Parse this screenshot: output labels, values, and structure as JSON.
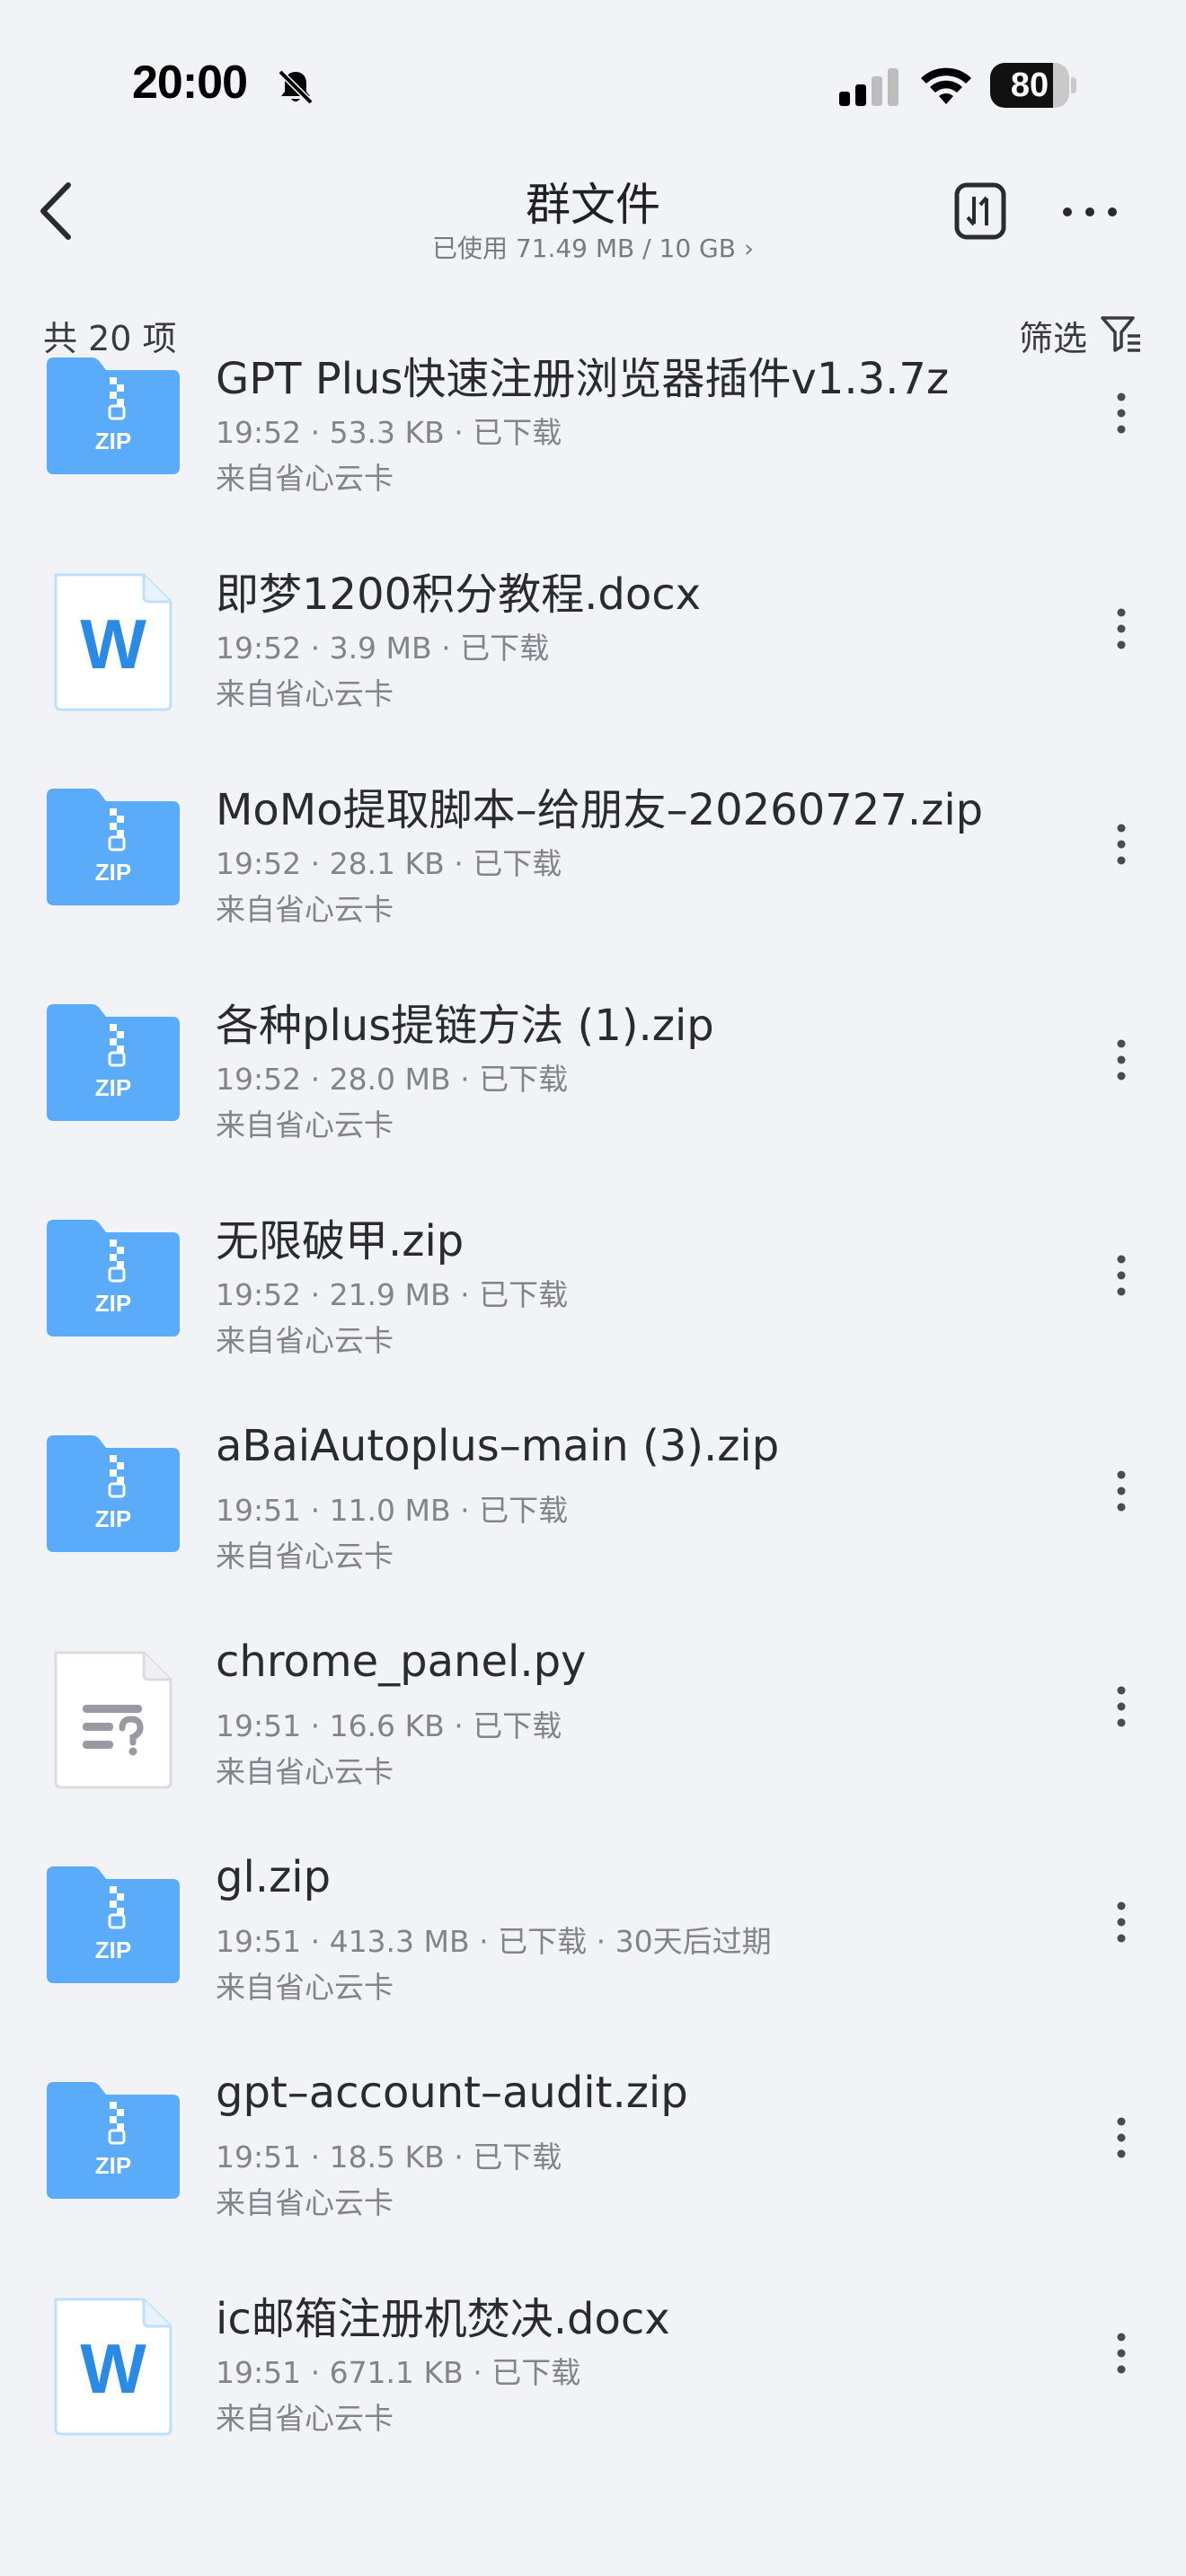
{
  "status": {
    "time": "20:00",
    "battery": "80",
    "battery_level": 0.8
  },
  "header": {
    "title": "群文件",
    "usage": "已使用 71.49 MB / 10 GB ›"
  },
  "toolbar": {
    "count": "共 20 项",
    "filter": "筛选"
  },
  "files": [
    {
      "icon": "zip",
      "name": "GPT Plus快速注册浏览器插件v1.3.7z",
      "meta": "19:52 · 53.3 KB · 已下载",
      "source": "来自省心云卡"
    },
    {
      "icon": "word",
      "name": "即梦1200积分教程.docx",
      "meta": "19:52 · 3.9 MB · 已下载",
      "source": "来自省心云卡"
    },
    {
      "icon": "zip",
      "name": "MoMo提取脚本–给朋友–20260727.zip",
      "meta": "19:52 · 28.1 KB · 已下载",
      "source": "来自省心云卡"
    },
    {
      "icon": "zip",
      "name": "各种plus提链方法 (1).zip",
      "meta": "19:52 · 28.0 MB · 已下载",
      "source": "来自省心云卡"
    },
    {
      "icon": "zip",
      "name": "无限破甲.zip",
      "meta": "19:52 · 21.9 MB · 已下载",
      "source": "来自省心云卡"
    },
    {
      "icon": "zip",
      "name": "aBaiAutoplus–main (3).zip",
      "meta": "19:51 · 11.0 MB · 已下载",
      "source": "来自省心云卡"
    },
    {
      "icon": "unknown",
      "name": "chrome_panel.py",
      "meta": "19:51 · 16.6 KB · 已下载",
      "source": "来自省心云卡"
    },
    {
      "icon": "zip",
      "name": "gl.zip",
      "meta": "19:51 · 413.3 MB · 已下载 · 30天后过期",
      "source": "来自省心云卡"
    },
    {
      "icon": "zip",
      "name": "gpt–account–audit.zip",
      "meta": "19:51 · 18.5 KB · 已下载",
      "source": "来自省心云卡"
    },
    {
      "icon": "word",
      "name": "ic邮箱注册机焚决.docx",
      "meta": "19:51 · 671.1 KB · 已下载",
      "source": "来自省心云卡"
    }
  ],
  "icon_labels": {
    "zip": "ZIP",
    "word": "W"
  },
  "colors": {
    "zip_blue": "#5aacfb",
    "word_blue": "#2a8be6",
    "background": "#f2f3f7"
  }
}
